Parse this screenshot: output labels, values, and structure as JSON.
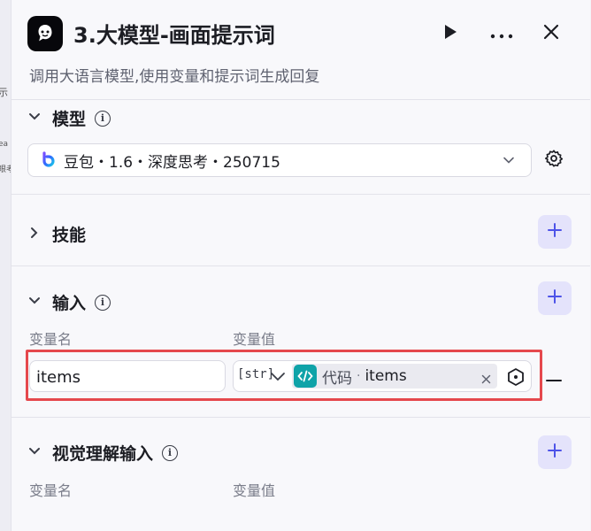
{
  "header": {
    "title": "3.大模型-画面提示词",
    "description": "调用大语言模型,使用变量和提示词生成回复",
    "run_icon": "play-icon",
    "more_icon": "more-dots-icon",
    "close_icon": "close-icon"
  },
  "background_fragments": [
    "示",
    "ea",
    "眼考"
  ],
  "model_section": {
    "title": "模型",
    "selected_model": "豆包・1.6・深度思考・250715",
    "settings_icon": "gear-icon"
  },
  "skills_section": {
    "title": "技能"
  },
  "input_section": {
    "title": "输入",
    "col_name": "变量名",
    "col_value": "变量值",
    "row": {
      "name": "items",
      "type": "[str]",
      "source": "代码",
      "separator": "·",
      "variable": "items"
    }
  },
  "visual_section": {
    "title": "视觉理解输入",
    "col_name": "变量名",
    "col_value": "变量值"
  },
  "colors": {
    "accent": "#4d53e8",
    "accent_bg": "#e4e3fb",
    "highlight": "#e5484d",
    "code_chip": "#0fa3a8"
  }
}
